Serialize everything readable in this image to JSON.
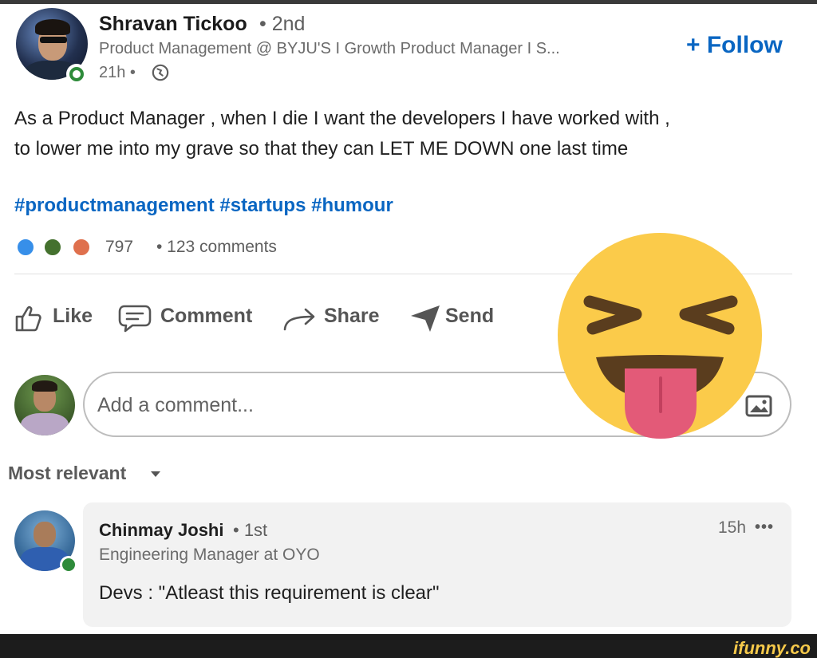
{
  "post": {
    "author": {
      "name": "Shravan Tickoo",
      "degree": "• 2nd",
      "headline": "Product Management @ BYJU'S I Growth Product Manager I S...",
      "time": "21h •"
    },
    "follow_label": "+ Follow",
    "text_lines": [
      "As a Product Manager , when I die I want the developers I have worked with ,",
      "to lower me into my grave so that they can LET ME DOWN one last time"
    ],
    "hashtags": [
      "#productmanagement",
      "#startups",
      "#humour"
    ],
    "reactions": {
      "count": "797",
      "comments": "• 123 comments",
      "icons": [
        "like-reaction",
        "celebrate-reaction",
        "love-reaction"
      ]
    }
  },
  "actions": {
    "like": "Like",
    "comment": "Comment",
    "share": "Share",
    "send": "Send"
  },
  "comment_box": {
    "placeholder": "Add a comment..."
  },
  "sort": {
    "label": "Most relevant"
  },
  "top_comment": {
    "name": "Chinmay Joshi",
    "degree": "• 1st",
    "headline": "Engineering Manager at OYO",
    "time": "15h",
    "more": "•••",
    "text": "Devs : \"Atleast this requirement is clear\""
  },
  "watermark": "ifunny.co",
  "colors": {
    "brand_blue": "#0a66c2",
    "online_green": "#2e8b3a",
    "emoji_yellow": "#fbcb4a",
    "tongue_pink": "#e35a78"
  }
}
